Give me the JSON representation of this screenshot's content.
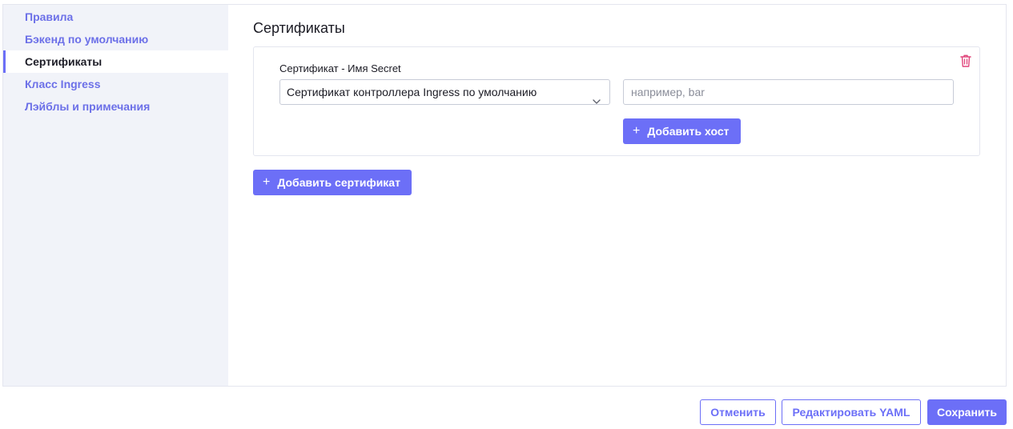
{
  "sidebar": {
    "items": [
      {
        "label": "Правила",
        "active": false
      },
      {
        "label": "Бэкенд по умолчанию",
        "active": false
      },
      {
        "label": "Сертификаты",
        "active": true
      },
      {
        "label": "Класс Ingress",
        "active": false
      },
      {
        "label": "Лэйблы и примечания",
        "active": false
      }
    ]
  },
  "main": {
    "title": "Сертификаты",
    "certificate": {
      "label": "Сертификат - Имя Secret",
      "selected_secret": "Сертификат контроллера Ingress по умолчанию",
      "host_placeholder": "например, bar",
      "host_value": "",
      "add_host_label": "Добавить хост",
      "delete_icon": "trash-icon"
    },
    "add_certificate_label": "Добавить сертификат"
  },
  "footer": {
    "cancel_label": "Отменить",
    "edit_yaml_label": "Редактировать YAML",
    "save_label": "Сохранить"
  },
  "colors": {
    "accent": "#6c6ff7",
    "sidebar_bg": "#f1f3f9",
    "danger": "#e0457b"
  }
}
